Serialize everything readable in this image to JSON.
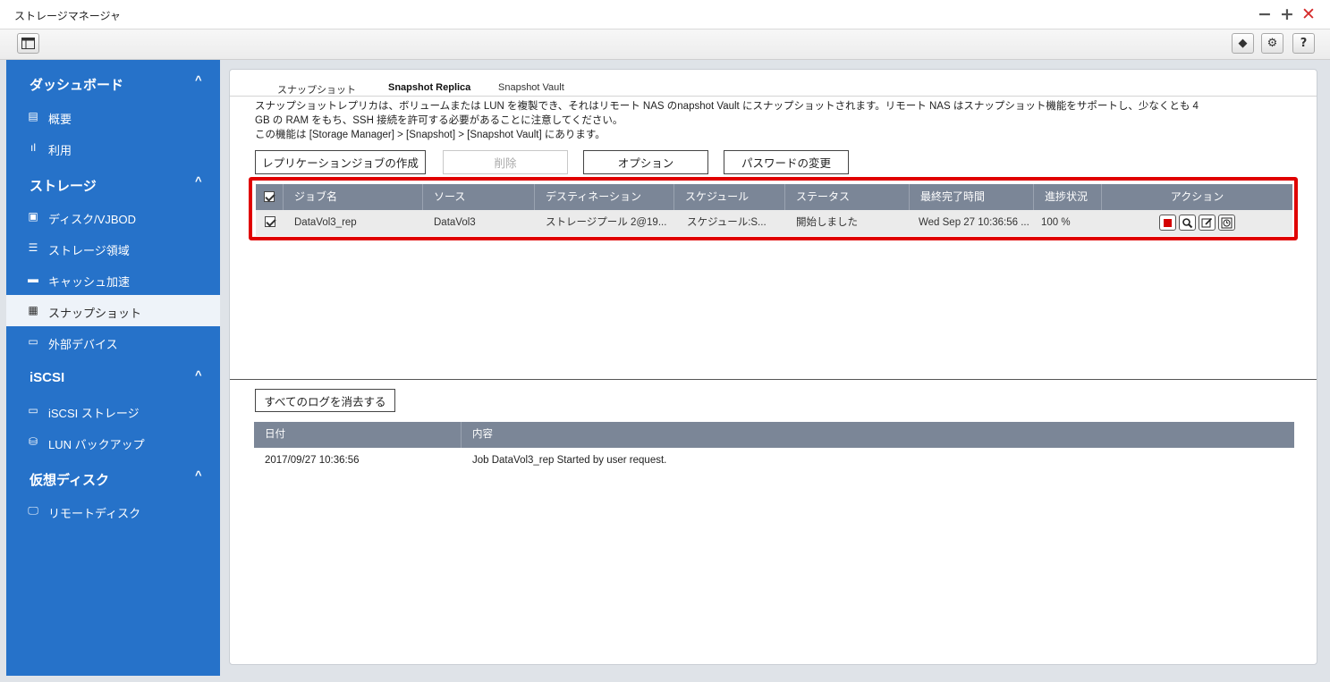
{
  "window": {
    "title": "ストレージマネージャ",
    "controls": {
      "minimize": "−",
      "maximize": "+",
      "close": "✕"
    }
  },
  "toolbar": {
    "sidebar_toggle_icon": "panel-icon",
    "right_buttons": [
      {
        "name": "app-icon",
        "glyph": "◆"
      },
      {
        "name": "gear-icon",
        "glyph": "⚙"
      },
      {
        "name": "help-icon",
        "glyph": "?"
      }
    ]
  },
  "sidebar": {
    "sections": [
      {
        "title": "ダッシュボード",
        "chevron": "^",
        "items": [
          {
            "label": "概要",
            "icon": "overview-icon"
          },
          {
            "label": "利用",
            "icon": "usage-icon"
          }
        ]
      },
      {
        "title": "ストレージ",
        "chevron": "^",
        "items": [
          {
            "label": "ディスク/VJBOD",
            "icon": "disk-icon"
          },
          {
            "label": "ストレージ領域",
            "icon": "storage-space-icon"
          },
          {
            "label": "キャッシュ加速",
            "icon": "cache-icon"
          },
          {
            "label": "スナップショット",
            "icon": "snapshot-icon",
            "active": true
          },
          {
            "label": "外部デバイス",
            "icon": "external-device-icon"
          }
        ]
      },
      {
        "title": "iSCSI",
        "chevron": "^",
        "items": [
          {
            "label": "iSCSI ストレージ",
            "icon": "iscsi-storage-icon"
          },
          {
            "label": "LUN バックアップ",
            "icon": "lun-backup-icon"
          }
        ]
      },
      {
        "title": "仮想ディスク",
        "chevron": "^",
        "items": [
          {
            "label": "リモートディスク",
            "icon": "remote-disk-icon"
          }
        ]
      }
    ]
  },
  "tabs": [
    "スナップショット",
    "Snapshot Replica",
    "Snapshot Vault"
  ],
  "active_tab": "Snapshot Replica",
  "description": {
    "line1": "スナップショットレプリカは、ボリュームまたは LUN を複製でき、それはリモート NAS のnapshot Vault にスナップショットされます。リモート NAS はスナップショット機能をサポートし、少なくとも 4",
    "line2": "GB の RAM をもち、SSH 接続を許可する必要があることに注意してください。",
    "line3": "この機能は [Storage Manager] > [Snapshot] > [Snapshot Vault] にあります。"
  },
  "buttons": {
    "create": "レプリケーションジョブの作成",
    "delete": "削除",
    "options": "オプション",
    "change_password": "パスワードの変更",
    "clear_logs": "すべてのログを消去する"
  },
  "job_table": {
    "columns": [
      "ジョブ名",
      "ソース",
      "デスティネーション",
      "スケジュール",
      "ステータス",
      "最終完了時間",
      "進捗状況",
      "アクション"
    ],
    "rows": [
      {
        "checked": true,
        "job_name": "DataVol3_rep",
        "source": "DataVol3",
        "destination": "ストレージプール 2@19...",
        "schedule": "スケジュール:S...",
        "status": "開始しました",
        "last_completed": "Wed Sep 27 10:36:56 ...",
        "progress": "100 %",
        "actions": [
          "stop-icon",
          "view-icon",
          "edit-icon",
          "history-icon"
        ]
      }
    ]
  },
  "log_table": {
    "columns": [
      "日付",
      "内容"
    ],
    "rows": [
      {
        "date": "2017/09/27 10:36:56",
        "content": "Job DataVol3_rep Started by user request."
      }
    ]
  }
}
